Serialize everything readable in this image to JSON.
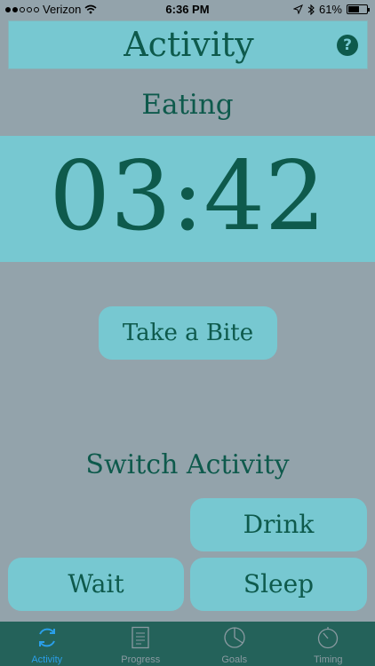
{
  "status_bar": {
    "carrier": "Verizon",
    "time": "6:36 PM",
    "battery": "61%",
    "battery_level": 0.61
  },
  "header": {
    "title": "Activity"
  },
  "activity": {
    "name": "Eating",
    "timer": "03:42",
    "primary_action": "Take a Bite"
  },
  "switch": {
    "title": "Switch Activity",
    "options": [
      "Drink",
      "Wait",
      "Sleep"
    ]
  },
  "tabs": [
    {
      "label": "Activity",
      "icon": "refresh-icon",
      "active": true
    },
    {
      "label": "Progress",
      "icon": "document-icon",
      "active": false
    },
    {
      "label": "Goals",
      "icon": "pie-chart-icon",
      "active": false
    },
    {
      "label": "Timing",
      "icon": "stopwatch-icon",
      "active": false
    }
  ],
  "colors": {
    "background": "#93a3ab",
    "accent": "#77c8d1",
    "text": "#0e5a4c",
    "tab_bar": "#24625a",
    "active_tab": "#2a9fea",
    "inactive_tab": "#8a9aa1"
  }
}
